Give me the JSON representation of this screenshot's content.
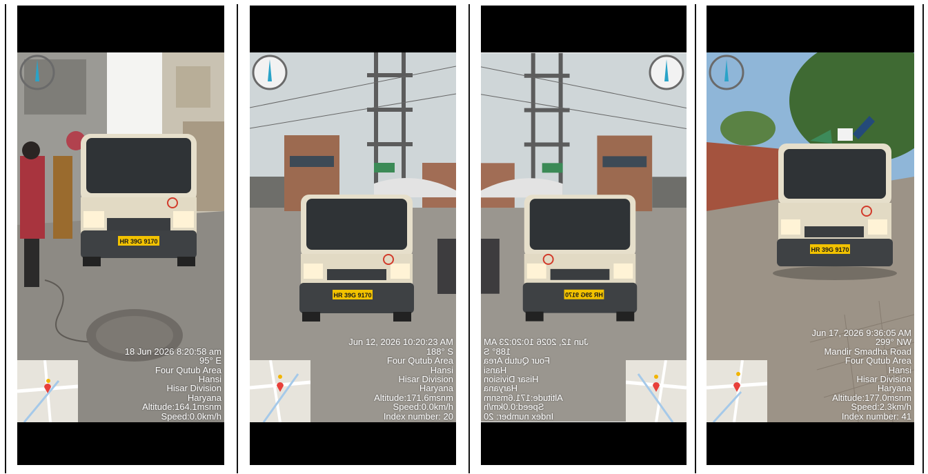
{
  "panels": [
    {
      "overlay_lines": [
        "18 Jun 2026 8:20:58 am",
        "95° E",
        "Four Qutub Area",
        "Hansi",
        "Hisar Division",
        "Haryana",
        "Altitude:164.1msnm",
        "Speed:0.0km/h"
      ],
      "plate": "HR 39G 9170",
      "badge": "2",
      "mirrored": false
    },
    {
      "overlay_lines": [
        "Jun 12, 2026 10:20:23 AM",
        "188° S",
        "Four Qutub Area",
        "Hansi",
        "Hisar Division",
        "Haryana",
        "Altitude:171.6msnm",
        "Speed:0.0km/h",
        "Index number: 20"
      ],
      "plate": "HR 39G 9170",
      "badge": "2",
      "mirrored": false
    },
    {
      "overlay_lines": [
        "Jun 12, 2026 10:20:23 AM",
        "188° S",
        "Four Qutub Area",
        "Hansi",
        "Hisar Division",
        "Haryana",
        "Altitude:171.6msnm",
        "Speed:0.0km/h",
        "Index number: 20"
      ],
      "plate": "HR 39G 9170",
      "badge": "2",
      "mirrored": true
    },
    {
      "overlay_lines": [
        "Jun 17, 2026 9:36:05 AM",
        "299° NW",
        "Mandir Smadha Road",
        "Four Qutub Area",
        "Hansi",
        "Hisar Division",
        "Haryana",
        "Altitude:177.0msnm",
        "Speed:2.3km/h",
        "Index number: 41"
      ],
      "plate": "HR 39G 9170",
      "badge": "2",
      "mirrored": false
    }
  ],
  "colors": {
    "sky_hazy": "#cfd6d8",
    "sky_blue": "#8fb6d8",
    "road": "#8d8a84",
    "van_body": "#e6dfcb",
    "plate": "#f2c200",
    "compass_needle": "#2aa3c8"
  }
}
